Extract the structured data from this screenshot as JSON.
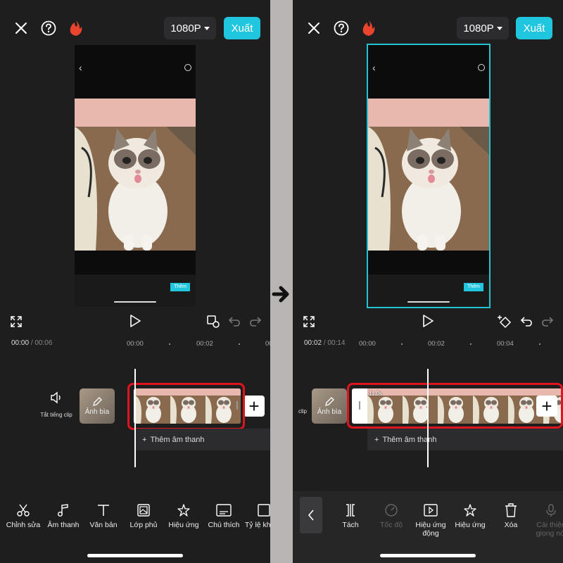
{
  "left": {
    "header": {
      "resolution": "1080P",
      "export_label": "Xuất"
    },
    "preview": {
      "button_label": "Thêm"
    },
    "timeline": {
      "current_time": "00:00",
      "total_time": "/ 00:06",
      "ruler": [
        "00:00",
        "00:02",
        "00"
      ],
      "mute_label": "Tắt tiếng clip",
      "cover_label": "Ảnh bìa",
      "add_audio": "Thêm âm thanh"
    },
    "toolbar": [
      {
        "icon": "scissors-icon",
        "label": "Chỉnh sửa"
      },
      {
        "icon": "music-note-icon",
        "label": "Âm thanh"
      },
      {
        "icon": "text-icon",
        "label": "Văn bản"
      },
      {
        "icon": "overlay-icon",
        "label": "Lớp phủ"
      },
      {
        "icon": "sparkle-star-icon",
        "label": "Hiệu ứng"
      },
      {
        "icon": "caption-icon",
        "label": "Chú thích"
      },
      {
        "icon": "aspect-ratio-icon",
        "label": "Tỷ lệ khung"
      }
    ]
  },
  "right": {
    "header": {
      "resolution": "1080P",
      "export_label": "Xuất"
    },
    "preview": {
      "button_label": "Thêm"
    },
    "timeline": {
      "current_time": "00:02",
      "total_time": "/ 00:14",
      "ruler": [
        "00:00",
        "00:02",
        "00:04"
      ],
      "mute_label": "clip",
      "cover_label": "Ảnh bìa",
      "clip_time": "11.0s",
      "add_audio": "Thêm âm thanh"
    },
    "toolbar": [
      {
        "icon": "split-icon",
        "label": "Tách",
        "enabled": true
      },
      {
        "icon": "speed-icon",
        "label": "Tốc độ",
        "enabled": false
      },
      {
        "icon": "motion-effect-icon",
        "label": "Hiệu ứng động",
        "enabled": true
      },
      {
        "icon": "sparkle-star-icon",
        "label": "Hiệu ứng",
        "enabled": true
      },
      {
        "icon": "trash-icon",
        "label": "Xóa",
        "enabled": true
      },
      {
        "icon": "voice-enhance-icon",
        "label": "Cải thiện giọng nói",
        "enabled": false
      }
    ]
  },
  "colors": {
    "accent": "#1fc6dd",
    "highlight": "#e0141e",
    "selection": "#22c3d6"
  }
}
